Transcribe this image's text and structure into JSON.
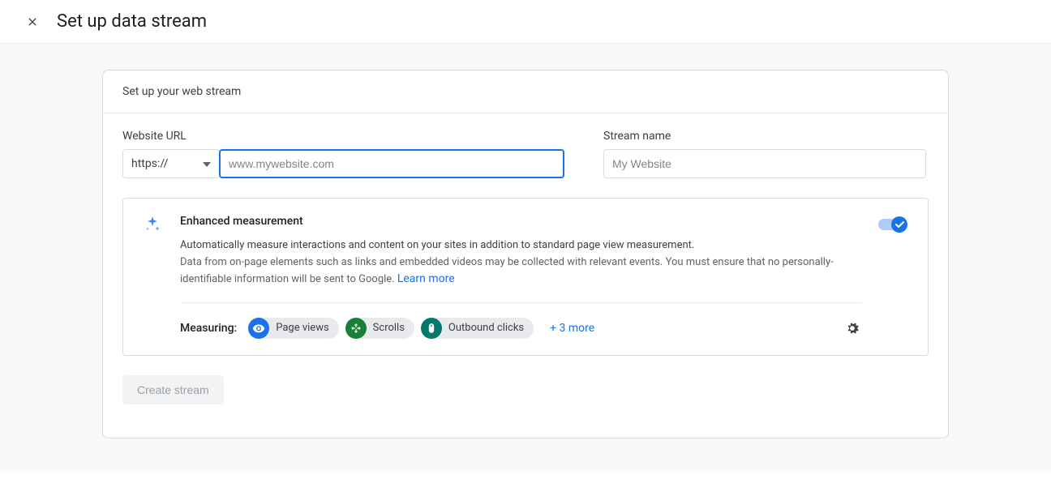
{
  "header": {
    "title": "Set up data stream"
  },
  "card": {
    "title": "Set up your web stream",
    "url_label": "Website URL",
    "protocol": "https://",
    "url_placeholder": "www.mywebsite.com",
    "stream_label": "Stream name",
    "stream_placeholder": "My Website"
  },
  "enhanced": {
    "title": "Enhanced measurement",
    "line1": "Automatically measure interactions and content on your sites in addition to standard page view measurement.",
    "line2": "Data from on-page elements such as links and embedded videos may be collected with relevant events. You must ensure that no personally-identifiable information will be sent to Google. ",
    "learn_more": "Learn more",
    "measuring_label": "Measuring:",
    "chips": [
      {
        "label": "Page views",
        "icon": "eye",
        "color": "blue"
      },
      {
        "label": "Scrolls",
        "icon": "arrows",
        "color": "green"
      },
      {
        "label": "Outbound clicks",
        "icon": "mouse",
        "color": "teal"
      }
    ],
    "more": "+ 3 more"
  },
  "create_label": "Create stream"
}
